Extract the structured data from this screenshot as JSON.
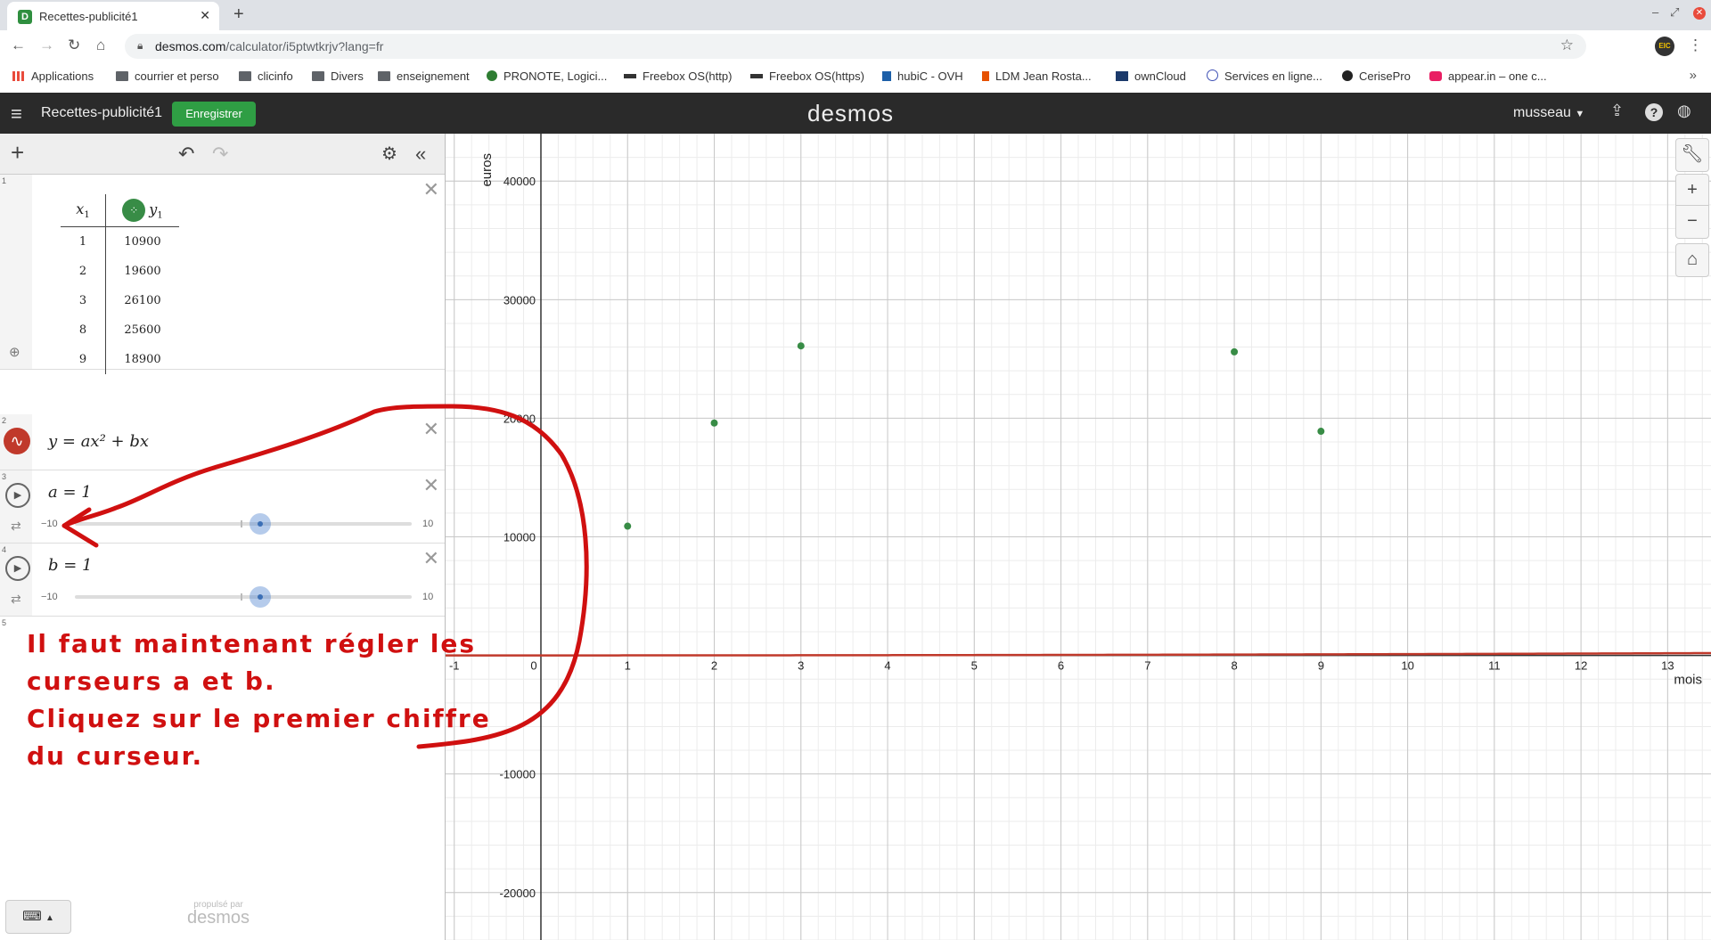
{
  "browser": {
    "tab_title": "Recettes-publicité1",
    "url_domain": "desmos.com",
    "url_rest": "/calculator/i5ptwtkrjv?lang=fr",
    "bookmarks": [
      "Applications",
      "courrier et perso",
      "clicinfo",
      "Divers",
      "enseignement",
      "PRONOTE, Logici...",
      "Freebox OS(http)",
      "Freebox OS(https)",
      "hubiC - OVH",
      "LDM Jean Rosta...",
      "ownCloud",
      "Services en ligne...",
      "CerisePro",
      "appear.in – one c..."
    ],
    "extension_label": "EIC"
  },
  "header": {
    "graph_title": "Recettes-publicité1",
    "save_label": "Enregistrer",
    "brand": "desmos",
    "user": "musseau"
  },
  "expressions": {
    "table": {
      "num": "1",
      "col1": "x",
      "col1_sub": "1",
      "col2": "y",
      "col2_sub": "1",
      "rows": [
        [
          "1",
          "10900"
        ],
        [
          "2",
          "19600"
        ],
        [
          "3",
          "26100"
        ],
        [
          "8",
          "25600"
        ],
        [
          "9",
          "18900"
        ]
      ]
    },
    "func": {
      "num": "2",
      "latex_text": "y = ax² + bx"
    },
    "slider_a": {
      "num": "3",
      "label": "a = 1",
      "min": "−10",
      "max": "10",
      "value_fraction": 0.55
    },
    "slider_b": {
      "num": "4",
      "label": "b = 1",
      "min": "−10",
      "max": "10",
      "value_fraction": 0.55
    },
    "empty": {
      "num": "5"
    }
  },
  "powered": {
    "small": "propulsé par",
    "brand": "desmos"
  },
  "annotation": {
    "lines": [
      "Il faut maintenant régler les",
      "curseurs a et b.",
      "Cliquez sur le premier chiffre",
      "du curseur."
    ],
    "color": "#d01010"
  },
  "chart_data": {
    "type": "scatter",
    "x_ticks": [
      "-1",
      "0",
      "1",
      "2",
      "3",
      "4",
      "5",
      "6",
      "7",
      "8",
      "9",
      "10",
      "11",
      "12",
      "13"
    ],
    "y_ticks": [
      "40000",
      "30000",
      "20000",
      "10000",
      "-10000",
      "-20000"
    ],
    "xlabel": "mois",
    "ylabel": "euros",
    "xlim": [
      -1.1,
      13.5
    ],
    "ylim": [
      -24000,
      44000
    ],
    "grid": true,
    "points": [
      [
        1,
        10900
      ],
      [
        2,
        19600
      ],
      [
        3,
        26100
      ],
      [
        8,
        25600
      ],
      [
        9,
        18900
      ]
    ],
    "point_color": "#388c46",
    "curve": {
      "a": 1,
      "b": 1,
      "color": "#c0392b"
    }
  }
}
